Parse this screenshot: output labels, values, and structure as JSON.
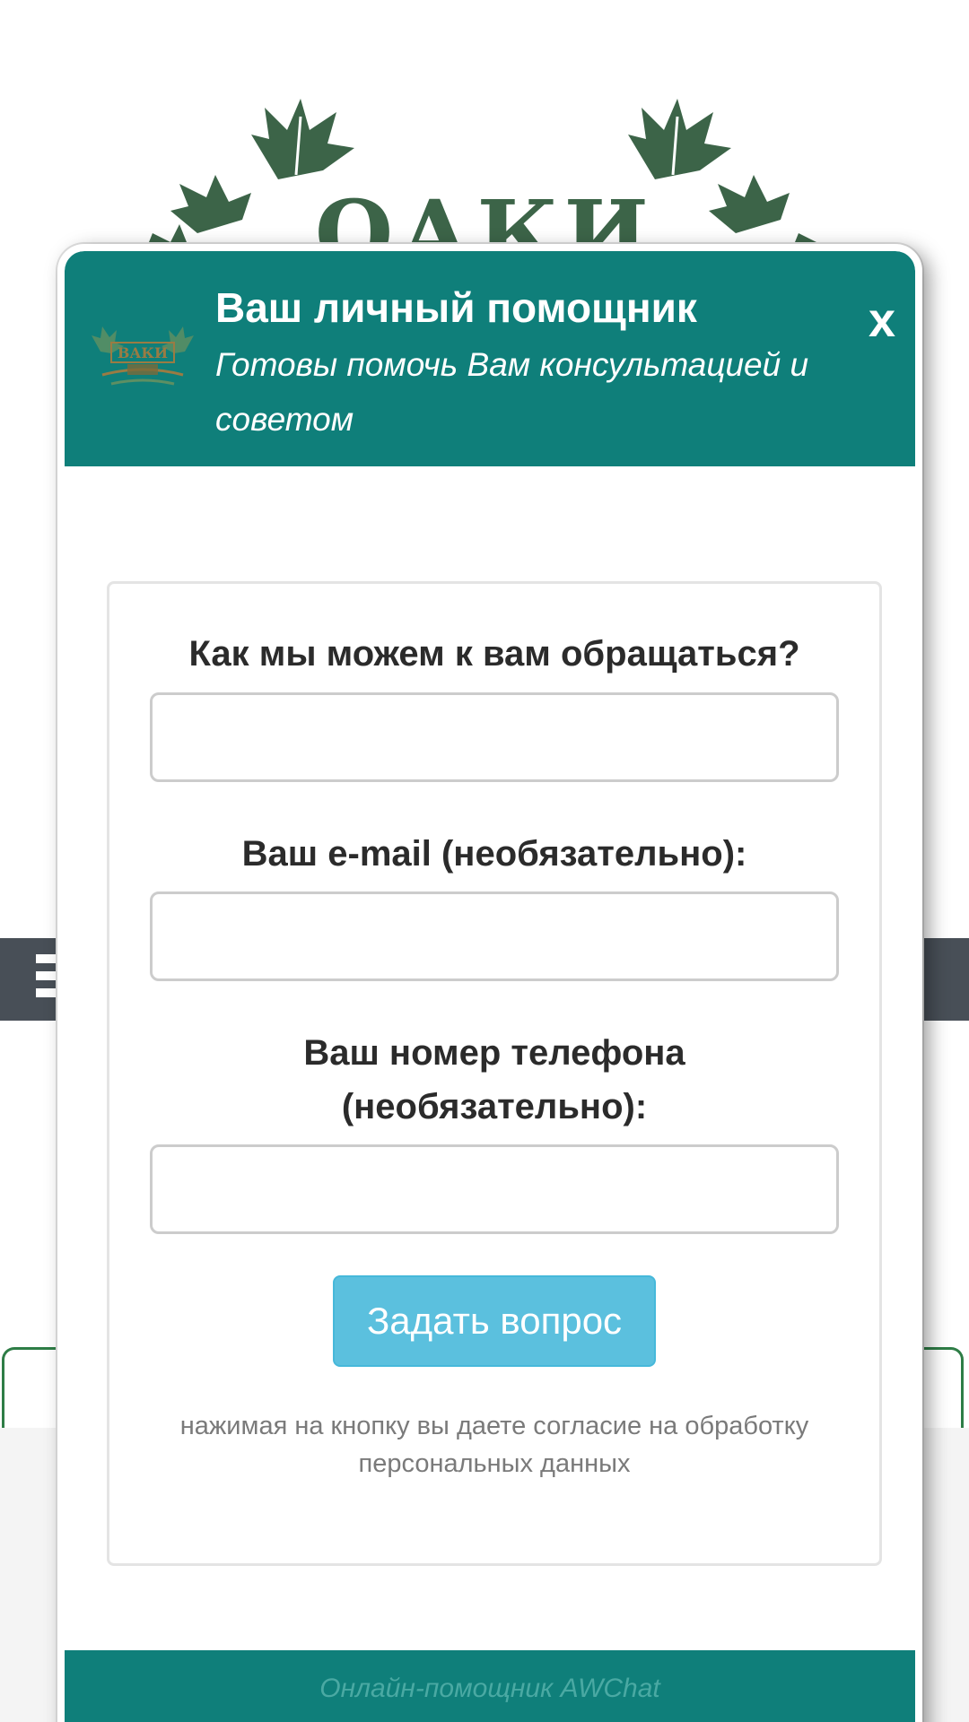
{
  "background": {
    "logo_text": "ОАКИ",
    "colors": {
      "leaf": "#3c6448",
      "navbar": "#484f57",
      "card_border": "#2e7d46"
    }
  },
  "chat_widget": {
    "header": {
      "title": "Ваш личный помощник",
      "subtitle": "Готовы помочь Вам консультацией и советом",
      "close_label": "x",
      "logo_icon": "company-logo-icon",
      "background_color": "#0f7f7a"
    },
    "form": {
      "name_label": "Как мы можем к вам обращаться?",
      "name_value": "",
      "email_label": "Ваш e-mail (необязательно):",
      "email_value": "",
      "phone_label": "Ваш номер телефона (необязательно):",
      "phone_value": "",
      "submit_label": "Задать вопрос",
      "submit_color": "#5bc0de",
      "consent_text": "нажимая на кнопку вы даете согласие на обработку персональных данных"
    },
    "footer": {
      "text": "Онлайн-помощник AWChat"
    }
  }
}
